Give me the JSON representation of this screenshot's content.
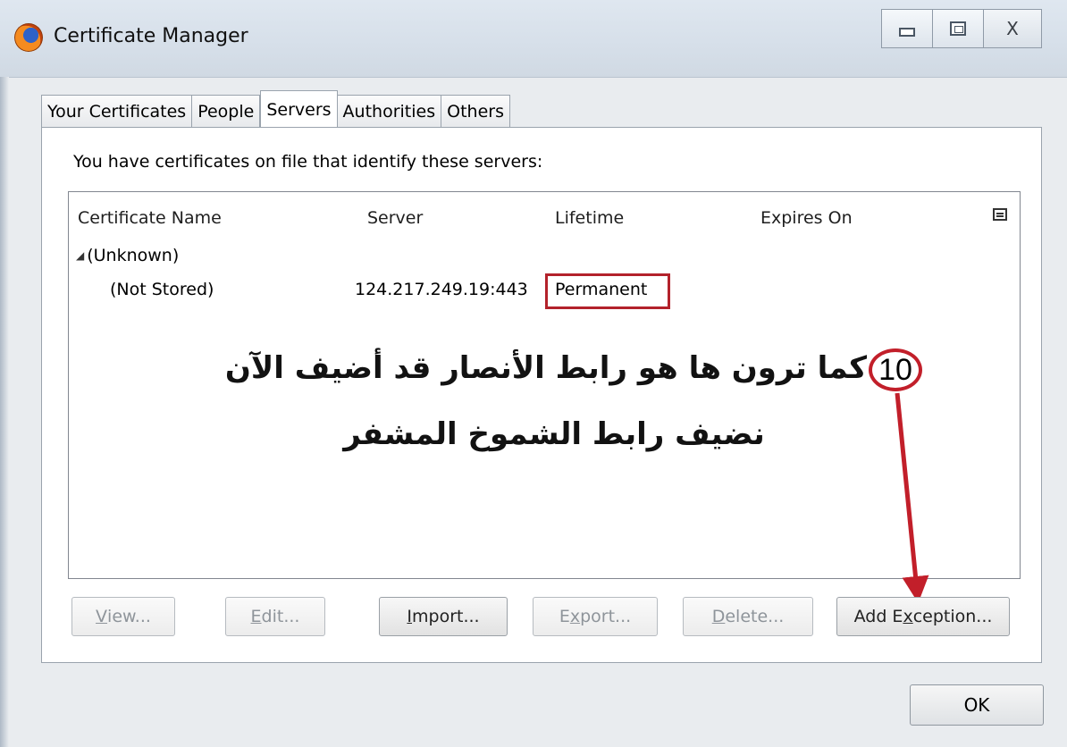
{
  "window": {
    "title": "Certificate Manager",
    "app_icon": "firefox-icon",
    "controls": [
      "minimize-icon",
      "maximize-icon",
      "close-icon"
    ],
    "close_label": "X"
  },
  "tabs": [
    {
      "label": "Your Certificates",
      "active": false
    },
    {
      "label": "People",
      "active": false
    },
    {
      "label": "Servers",
      "active": true
    },
    {
      "label": "Authorities",
      "active": false
    },
    {
      "label": "Others",
      "active": false
    }
  ],
  "panel": {
    "description": "You have certificates on file that identify these servers:",
    "columns": [
      "Certificate Name",
      "Server",
      "Lifetime",
      "Expires On"
    ],
    "column_picker_icon": "column-picker-icon",
    "group": {
      "label": "(Unknown)",
      "expanded": true
    },
    "rows": [
      {
        "name": "(Not Stored)",
        "server": "124.217.249.19:443",
        "lifetime": "Permanent",
        "expires": ""
      }
    ]
  },
  "annotation": {
    "step": "10",
    "line1": "كما ترون ها هو رابط الأنصار قد أضيف الآن",
    "line2": "نضيف رابط الشموخ المشفر",
    "color": "#c21f2a"
  },
  "buttons": {
    "view": {
      "pre": "",
      "key": "V",
      "post": "iew..."
    },
    "edit": {
      "pre": "",
      "key": "E",
      "post": "dit..."
    },
    "import": {
      "pre": "",
      "key": "I",
      "post": "mport..."
    },
    "export": {
      "pre": "E",
      "key": "x",
      "post": "port..."
    },
    "delete": {
      "pre": "",
      "key": "D",
      "post": "elete..."
    },
    "add_exception": {
      "pre": "Add E",
      "key": "x",
      "post": "ception..."
    },
    "ok": "OK"
  }
}
